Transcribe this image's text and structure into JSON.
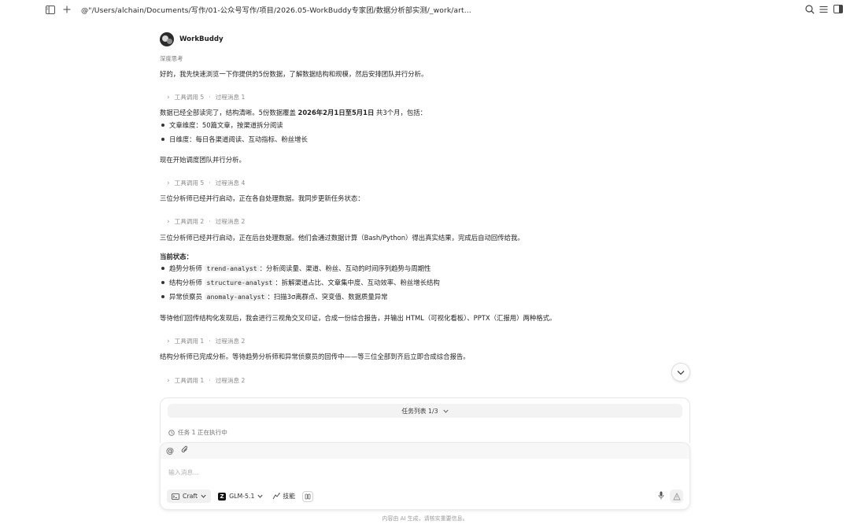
{
  "window": {
    "path": "@\"/Users/alchain/Documents/写作/01-公众号写作/项目/2026.05-WorkBuddy专家团/数据分析部实测/_work/art..."
  },
  "agent": {
    "name": "WorkBuddy",
    "thinking_label": "深度思考"
  },
  "messages": {
    "m1": "好的，我先快速浏览一下你提供的5份数据，了解数据结构和规模，然后安排团队并行分析。",
    "tool1": {
      "tool_label": "工具调用",
      "tool_count": "5",
      "msg_label": "过程消息",
      "msg_count": "1"
    },
    "m2_prefix": "数据已经全部读完了，结构清晰。5份数据覆盖 ",
    "m2_bold": "2026年2月1日至5月1日",
    "m2_suffix": " 共3个月，包括：",
    "b1": "文章维度：50篇文章，按渠道拆分阅读",
    "b2": "日维度：每日各渠道阅读、互动指标、粉丝增长",
    "m3": "现在开始调度团队并行分析。",
    "tool2": {
      "tool_label": "工具调用",
      "tool_count": "5",
      "msg_label": "过程消息",
      "msg_count": "4"
    },
    "m4": "三位分析师已经并行启动，正在各自处理数据。我同步更新任务状态：",
    "tool3": {
      "tool_label": "工具调用",
      "tool_count": "2",
      "msg_label": "过程消息",
      "msg_count": "2"
    },
    "m5": "三位分析师已经并行启动，正在后台处理数据。他们会通过数据计算（Bash/Python）得出真实结果，完成后自动回传给我。",
    "status_title": "当前状态：",
    "s1_prefix": "趋势分析师 ",
    "s1_code": "trend-analyst",
    "s1_suffix": "：分析阅读量、渠道、粉丝、互动的时间序列趋势与周期性",
    "s2_prefix": "结构分析师 ",
    "s2_code": "structure-analyst",
    "s2_suffix": "：拆解渠道占比、文章集中度、互动效率、粉丝增长结构",
    "s3_prefix": "异常侦察员 ",
    "s3_code": "anomaly-analyst",
    "s3_suffix": "：扫描3σ离群点、突变值、数据质量异常",
    "m6": "等待他们回传结构化发现后，我会进行三视角交叉印证，合成一份综合报告，并输出 HTML（可视化看板）、PPTX（汇报用）两种格式。",
    "tool4": {
      "tool_label": "工具调用",
      "tool_count": "1",
      "msg_label": "过程消息",
      "msg_count": "2"
    },
    "m7": "结构分析师已完成分析。等待趋势分析师和异常侦察员的回传中——等三位全部到齐后立即合成综合报告。",
    "tool5": {
      "tool_label": "工具调用",
      "tool_count": "1",
      "msg_label": "过程消息",
      "msg_count": "2"
    }
  },
  "tasks": {
    "list_label": "任务列表 1/3",
    "status": "任务 1 正在执行中"
  },
  "composer": {
    "placeholder": "输入消息...",
    "mode_label": "Craft",
    "model_label": "GLM-5.1",
    "model_logo": "Z",
    "skills_label": "技能"
  },
  "footer": {
    "disclaimer": "内容由 AI 生成，请核实重要信息。"
  }
}
